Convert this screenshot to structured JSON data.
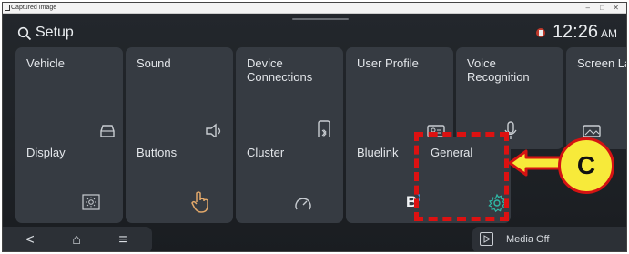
{
  "window": {
    "title": "Captured Image",
    "minimize": "–",
    "maximize": "□",
    "close": "✕"
  },
  "header": {
    "title": "Setup",
    "time": "12:26",
    "ampm": "AM"
  },
  "tiles": [
    {
      "label": "Vehicle",
      "icon": "car-icon"
    },
    {
      "label": "Sound",
      "icon": "speaker-icon"
    },
    {
      "label": "Device\nConnections",
      "icon": "phone-bluetooth-icon"
    },
    {
      "label": "User Profile",
      "icon": "id-card-icon"
    },
    {
      "label": "Voice\nRecognition",
      "icon": "microphone-icon"
    },
    {
      "label": "Screen Layout",
      "icon": "picture-icon"
    },
    {
      "label": "Display",
      "icon": "brightness-icon"
    },
    {
      "label": "Buttons",
      "icon": "hand-pointer-icon"
    },
    {
      "label": "Cluster",
      "icon": "gauge-icon"
    },
    {
      "label": "Bluelink",
      "icon": "bluelink-icon",
      "icon_text": "B"
    },
    {
      "label": "General",
      "icon": "gear-icon"
    }
  ],
  "nav": {
    "back": "<",
    "home": "⌂",
    "menu": "≡"
  },
  "media": {
    "label": "Media Off"
  },
  "callout": {
    "label": "C",
    "color": "#dd1111",
    "badge_color": "#f7ea3a"
  }
}
